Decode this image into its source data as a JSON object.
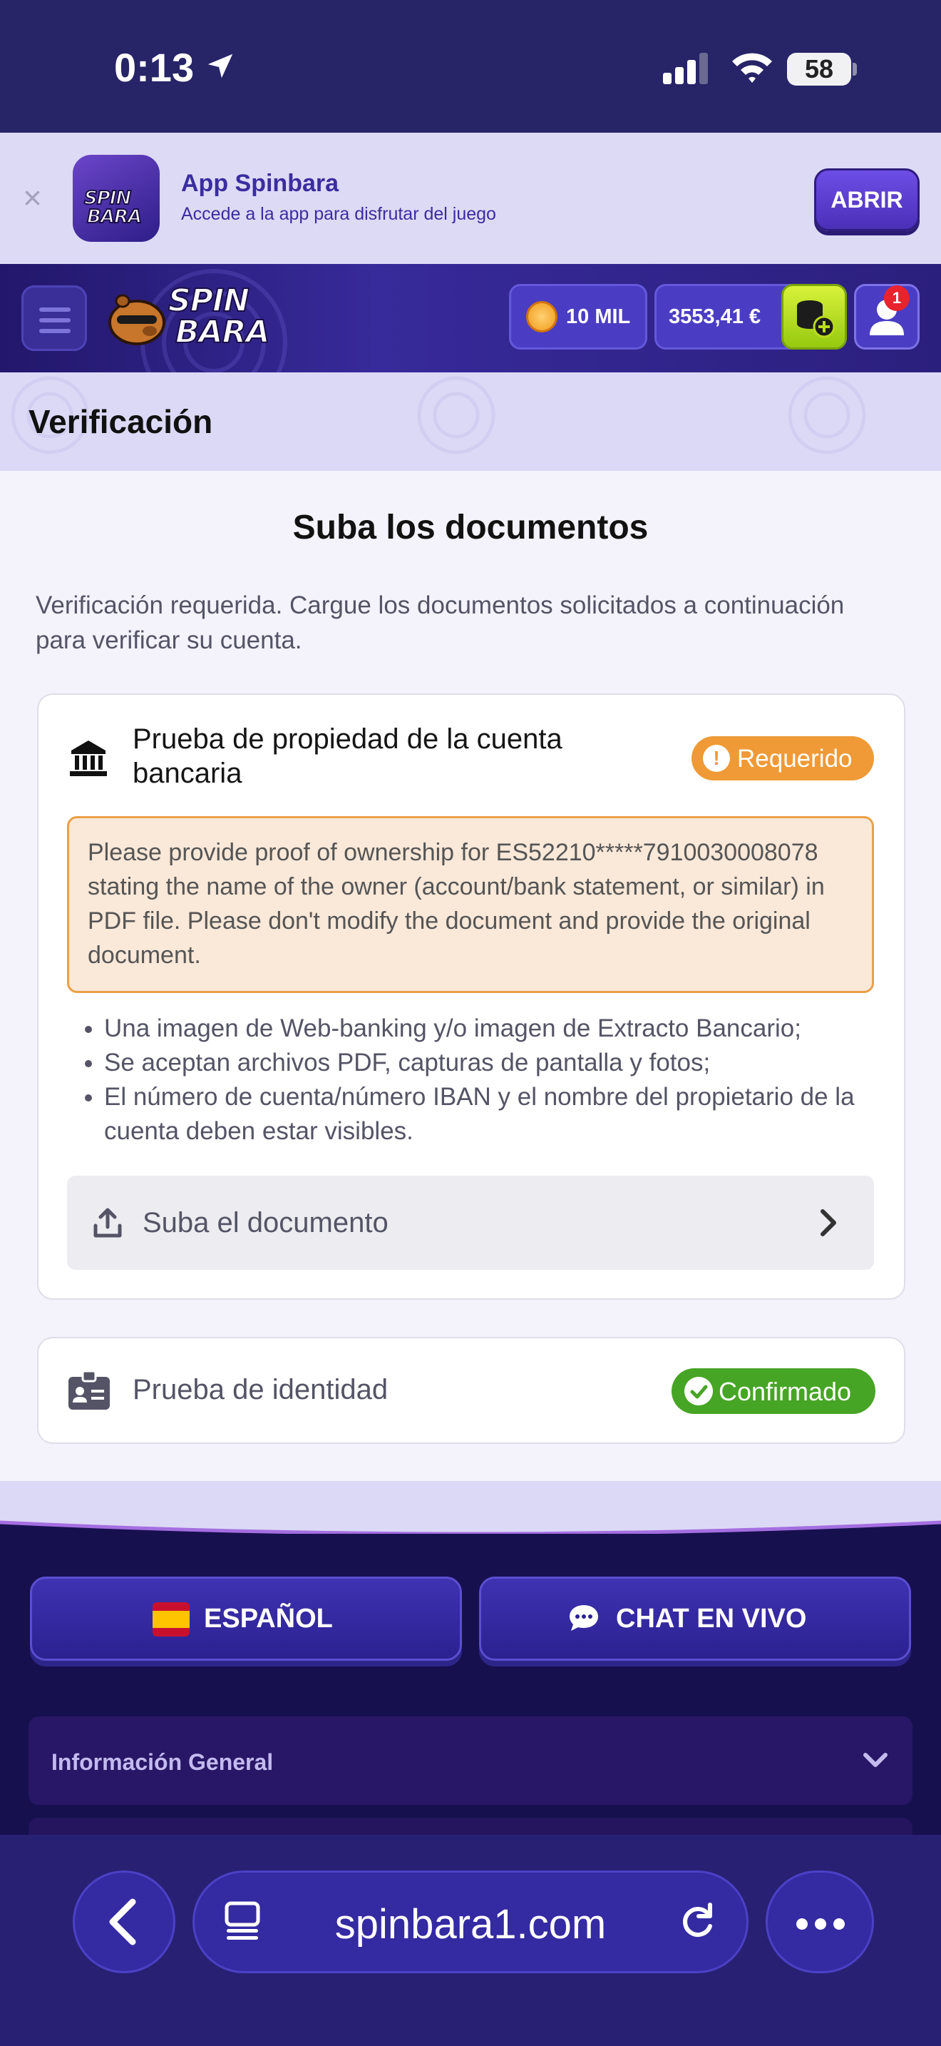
{
  "status_bar": {
    "time": "0:13",
    "battery": "58"
  },
  "app_banner": {
    "app_name": "App Spinbara",
    "description": "Accede a la app para disfrutar del juego",
    "open_label": "ABRIR",
    "close_glyph": "×",
    "icon_text": [
      "SPIN",
      "BARA"
    ]
  },
  "header": {
    "logo_text": [
      "SPIN",
      "BARA"
    ],
    "coins": "10 MIL",
    "balance": "3553,41 €",
    "notification_count": "1"
  },
  "page": {
    "title": "Verificación",
    "section_title": "Suba los documentos",
    "intro": "Verificación requerida. Cargue los documentos solicitados a continuación para verificar su cuenta."
  },
  "bank_proof": {
    "title": "Prueba de propiedad de la cuenta bancaria",
    "status": "Requerido",
    "status_glyph": "!",
    "note": "Please provide proof of ownership for ES52210*****7910030008078 stating the name of the owner (account/bank statement, or similar) in PDF file. Please don't modify the document and provide the original document.",
    "requirements": [
      "Una imagen de Web-banking y/o imagen de Extracto Bancario;",
      "Se aceptan archivos PDF, capturas de pantalla y fotos;",
      "El número de cuenta/número IBAN y el nombre del propietario de la cuenta deben estar visibles."
    ],
    "upload_label": "Suba el documento"
  },
  "identity_proof": {
    "title": "Prueba de identidad",
    "status": "Confirmado"
  },
  "footer": {
    "language_label": "ESPAÑOL",
    "chat_label": "CHAT EN VIVO",
    "accordion_label": "Información General"
  },
  "browser": {
    "url": "spinbara1.com"
  },
  "colors": {
    "status_bar": "#272468",
    "header": "#2b1f7d",
    "required_badge": "#ef9a36",
    "confirmed_badge": "#46a524",
    "footer": "#16104f",
    "browser_bar": "#282173"
  },
  "icons": [
    "location-arrow-icon",
    "signal-icon",
    "wifi-icon",
    "battery-icon",
    "close-icon",
    "menu-icon",
    "coin-icon",
    "deposit-icon",
    "user-icon",
    "bank-icon",
    "alert-icon",
    "upload-icon",
    "chevron-right-icon",
    "id-card-icon",
    "check-icon",
    "spain-flag-icon",
    "chat-icon",
    "chevron-down-icon",
    "back-icon",
    "tabs-icon",
    "reload-icon",
    "more-icon"
  ]
}
